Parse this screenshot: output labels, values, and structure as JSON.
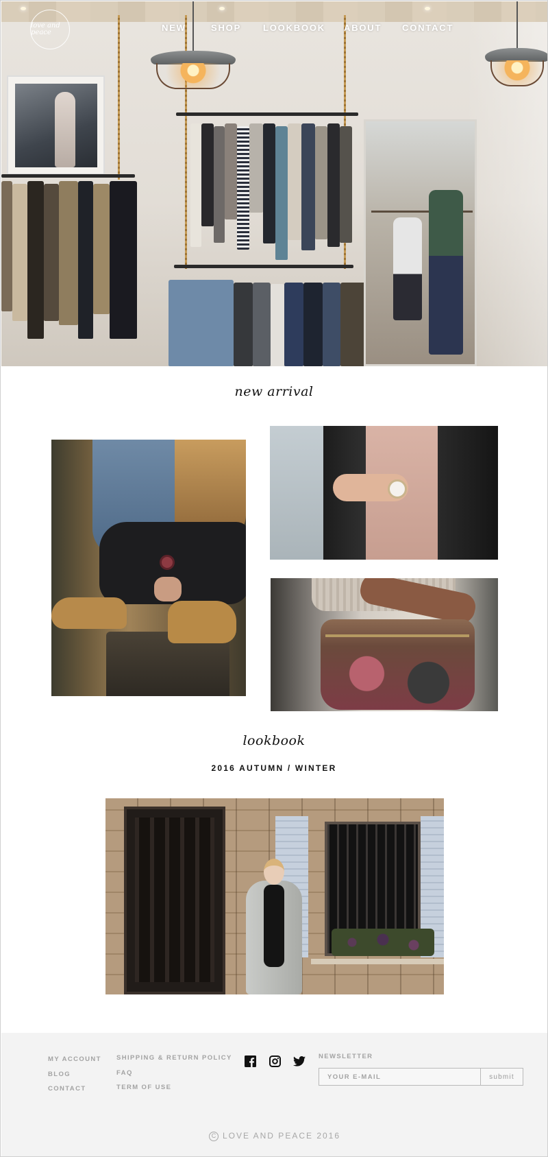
{
  "header": {
    "logo_text": "love and peace",
    "nav": [
      "NEW",
      "SHOP",
      "LOOKBOOK",
      "ABOUT",
      "CONTACT"
    ]
  },
  "new_arrival": {
    "title": "new arrival"
  },
  "lookbook": {
    "title": "lookbook",
    "subtitle": "2016 AUTUMN / WINTER"
  },
  "footer": {
    "col1": [
      "MY ACCOUNT",
      "BLOG",
      "CONTACT"
    ],
    "col2": [
      "SHIPPING & RETURN POLICY",
      "FAQ",
      "TERM OF USE"
    ],
    "social_icons": [
      "facebook-icon",
      "instagram-icon",
      "twitter-icon"
    ],
    "newsletter_label": "NEWSLETTER",
    "email_placeholder": "YOUR E-MAIL",
    "submit_label": "submit",
    "copyright_symbol": "C",
    "copyright": "LOVE AND PEACE 2016"
  },
  "colors": {
    "footer_bg": "#f3f3f3",
    "footer_text": "#a3a3a3",
    "heading": "#111111"
  }
}
